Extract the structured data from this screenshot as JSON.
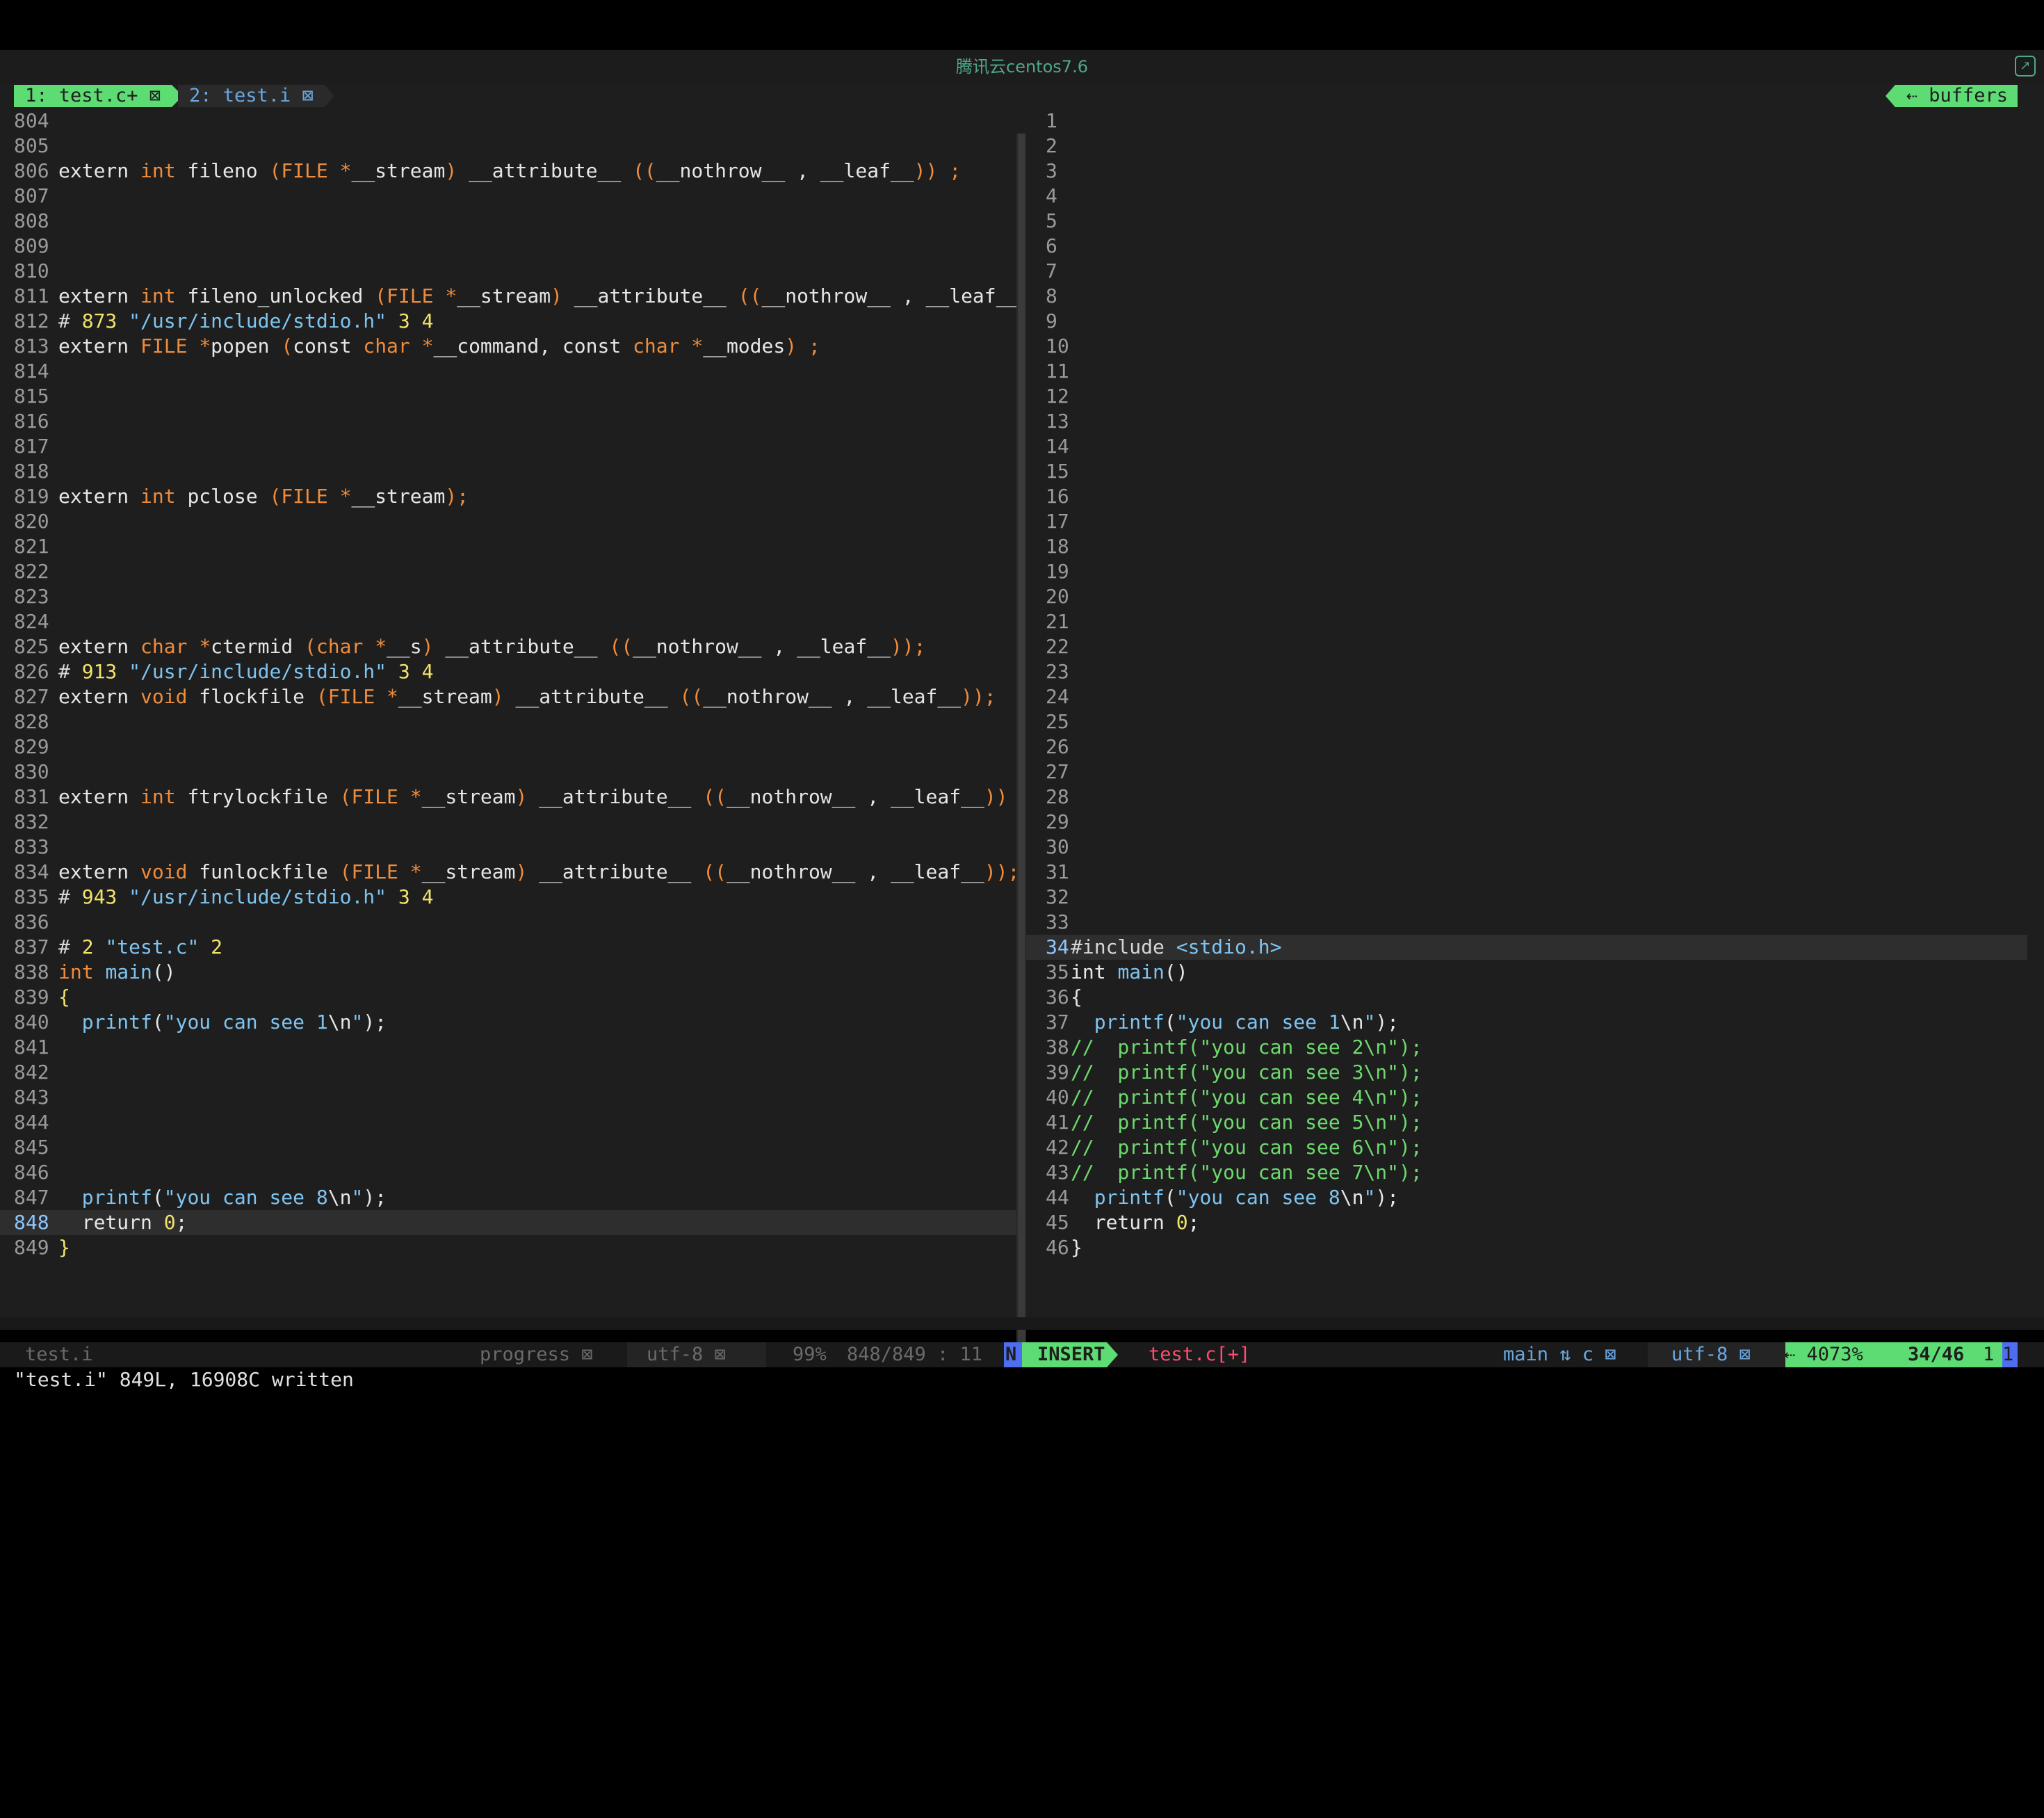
{
  "window": {
    "title": "腾讯云centos7.6",
    "share_icon": "share-icon"
  },
  "tabline": {
    "tabs": [
      {
        "label": "1: test.c+ ⊠",
        "active": true
      },
      {
        "label": "2: test.i ⊠",
        "active": false
      }
    ],
    "buffers_label": "⇠ buffers"
  },
  "left_pane": {
    "file": "test.i",
    "lines": [
      {
        "n": "804",
        "tokens": []
      },
      {
        "n": "805",
        "tokens": []
      },
      {
        "n": "806",
        "tokens": [
          [
            "kw",
            "extern "
          ],
          [
            "ty",
            "int"
          ],
          [
            "kw",
            " fileno "
          ],
          [
            "pn",
            "("
          ],
          [
            "ty",
            "FILE "
          ],
          [
            "pn",
            "*"
          ],
          [
            "kw",
            "__stream"
          ],
          [
            "pn",
            ")"
          ],
          [
            "kw",
            " __attribute__ "
          ],
          [
            "pn",
            "(("
          ],
          [
            "kw",
            "__nothrow__ , __leaf__"
          ],
          [
            "pn",
            "))"
          ],
          [
            "kw",
            " "
          ],
          [
            "pn",
            ";"
          ]
        ]
      },
      {
        "n": "807",
        "tokens": []
      },
      {
        "n": "808",
        "tokens": []
      },
      {
        "n": "809",
        "tokens": []
      },
      {
        "n": "810",
        "tokens": []
      },
      {
        "n": "811",
        "tokens": [
          [
            "kw",
            "extern "
          ],
          [
            "ty",
            "int"
          ],
          [
            "kw",
            " fileno_unlocked "
          ],
          [
            "pn",
            "("
          ],
          [
            "ty",
            "FILE "
          ],
          [
            "pn",
            "*"
          ],
          [
            "kw",
            "__stream"
          ],
          [
            "pn",
            ")"
          ],
          [
            "kw",
            " __attribute__ "
          ],
          [
            "pn",
            "(("
          ],
          [
            "kw",
            "__nothrow__ , __leaf__"
          ],
          [
            "pn",
            "))"
          ],
          [
            "kw",
            " "
          ],
          [
            "pn",
            ";"
          ]
        ]
      },
      {
        "n": "812",
        "tokens": [
          [
            "pp",
            "# "
          ],
          [
            "nm",
            "873"
          ],
          [
            "kw",
            " "
          ],
          [
            "st",
            "\"/usr/include/stdio.h\""
          ],
          [
            "kw",
            " "
          ],
          [
            "nm",
            "3 4"
          ]
        ]
      },
      {
        "n": "813",
        "tokens": [
          [
            "kw",
            "extern "
          ],
          [
            "ty",
            "FILE"
          ],
          [
            "kw",
            " "
          ],
          [
            "pn",
            "*"
          ],
          [
            "kw",
            "popen "
          ],
          [
            "pn",
            "("
          ],
          [
            "kw",
            "const "
          ],
          [
            "ty",
            "char"
          ],
          [
            "kw",
            " "
          ],
          [
            "pn",
            "*"
          ],
          [
            "kw",
            "__command, const "
          ],
          [
            "ty",
            "char"
          ],
          [
            "kw",
            " "
          ],
          [
            "pn",
            "*"
          ],
          [
            "kw",
            "__modes"
          ],
          [
            "pn",
            ")"
          ],
          [
            "kw",
            " "
          ],
          [
            "pn",
            ";"
          ]
        ]
      },
      {
        "n": "814",
        "tokens": []
      },
      {
        "n": "815",
        "tokens": []
      },
      {
        "n": "816",
        "tokens": []
      },
      {
        "n": "817",
        "tokens": []
      },
      {
        "n": "818",
        "tokens": []
      },
      {
        "n": "819",
        "tokens": [
          [
            "kw",
            "extern "
          ],
          [
            "ty",
            "int"
          ],
          [
            "kw",
            " pclose "
          ],
          [
            "pn",
            "("
          ],
          [
            "ty",
            "FILE "
          ],
          [
            "pn",
            "*"
          ],
          [
            "kw",
            "__stream"
          ],
          [
            "pn",
            ");"
          ]
        ]
      },
      {
        "n": "820",
        "tokens": []
      },
      {
        "n": "821",
        "tokens": []
      },
      {
        "n": "822",
        "tokens": []
      },
      {
        "n": "823",
        "tokens": []
      },
      {
        "n": "824",
        "tokens": []
      },
      {
        "n": "825",
        "tokens": [
          [
            "kw",
            "extern "
          ],
          [
            "ty",
            "char"
          ],
          [
            "kw",
            " "
          ],
          [
            "pn",
            "*"
          ],
          [
            "kw",
            "ctermid "
          ],
          [
            "pn",
            "("
          ],
          [
            "ty",
            "char"
          ],
          [
            "kw",
            " "
          ],
          [
            "pn",
            "*"
          ],
          [
            "kw",
            "__s"
          ],
          [
            "pn",
            ")"
          ],
          [
            "kw",
            " __attribute__ "
          ],
          [
            "pn",
            "(("
          ],
          [
            "kw",
            "__nothrow__ , __leaf__"
          ],
          [
            "pn",
            "));"
          ]
        ]
      },
      {
        "n": "826",
        "tokens": [
          [
            "pp",
            "# "
          ],
          [
            "nm",
            "913"
          ],
          [
            "kw",
            " "
          ],
          [
            "st",
            "\"/usr/include/stdio.h\""
          ],
          [
            "kw",
            " "
          ],
          [
            "nm",
            "3 4"
          ]
        ]
      },
      {
        "n": "827",
        "tokens": [
          [
            "kw",
            "extern "
          ],
          [
            "ty",
            "void"
          ],
          [
            "kw",
            " flockfile "
          ],
          [
            "pn",
            "("
          ],
          [
            "ty",
            "FILE "
          ],
          [
            "pn",
            "*"
          ],
          [
            "kw",
            "__stream"
          ],
          [
            "pn",
            ")"
          ],
          [
            "kw",
            " __attribute__ "
          ],
          [
            "pn",
            "(("
          ],
          [
            "kw",
            "__nothrow__ , __leaf__"
          ],
          [
            "pn",
            "));"
          ]
        ]
      },
      {
        "n": "828",
        "tokens": []
      },
      {
        "n": "829",
        "tokens": []
      },
      {
        "n": "830",
        "tokens": []
      },
      {
        "n": "831",
        "tokens": [
          [
            "kw",
            "extern "
          ],
          [
            "ty",
            "int"
          ],
          [
            "kw",
            " ftrylockfile "
          ],
          [
            "pn",
            "("
          ],
          [
            "ty",
            "FILE "
          ],
          [
            "pn",
            "*"
          ],
          [
            "kw",
            "__stream"
          ],
          [
            "pn",
            ")"
          ],
          [
            "kw",
            " __attribute__ "
          ],
          [
            "pn",
            "(("
          ],
          [
            "kw",
            "__nothrow__ , __leaf__"
          ],
          [
            "pn",
            "))"
          ],
          [
            "kw",
            " "
          ],
          [
            "pn",
            ";"
          ]
        ]
      },
      {
        "n": "832",
        "tokens": []
      },
      {
        "n": "833",
        "tokens": []
      },
      {
        "n": "834",
        "tokens": [
          [
            "kw",
            "extern "
          ],
          [
            "ty",
            "void"
          ],
          [
            "kw",
            " funlockfile "
          ],
          [
            "pn",
            "("
          ],
          [
            "ty",
            "FILE "
          ],
          [
            "pn",
            "*"
          ],
          [
            "kw",
            "__stream"
          ],
          [
            "pn",
            ")"
          ],
          [
            "kw",
            " __attribute__ "
          ],
          [
            "pn",
            "(("
          ],
          [
            "kw",
            "__nothrow__ , __leaf__"
          ],
          [
            "pn",
            "));"
          ]
        ]
      },
      {
        "n": "835",
        "tokens": [
          [
            "pp",
            "# "
          ],
          [
            "nm",
            "943"
          ],
          [
            "kw",
            " "
          ],
          [
            "st",
            "\"/usr/include/stdio.h\""
          ],
          [
            "kw",
            " "
          ],
          [
            "nm",
            "3 4"
          ]
        ]
      },
      {
        "n": "836",
        "tokens": []
      },
      {
        "n": "837",
        "tokens": [
          [
            "pp",
            "# "
          ],
          [
            "nm",
            "2"
          ],
          [
            "kw",
            " "
          ],
          [
            "st",
            "\"test.c\""
          ],
          [
            "kw",
            " "
          ],
          [
            "nm",
            "2"
          ]
        ]
      },
      {
        "n": "838",
        "tokens": [
          [
            "ty",
            "int"
          ],
          [
            "kw",
            " "
          ],
          [
            "st",
            "main"
          ],
          [
            "kw",
            "()"
          ]
        ]
      },
      {
        "n": "839",
        "tokens": [
          [
            "nm",
            "{"
          ]
        ]
      },
      {
        "n": "840",
        "tokens": [
          [
            "kw",
            "  "
          ],
          [
            "st",
            "printf"
          ],
          [
            "kw",
            "("
          ],
          [
            "st",
            "\"you can see 1"
          ],
          [
            "kw",
            "\\n"
          ],
          [
            "st",
            "\""
          ],
          [
            "kw",
            ");"
          ]
        ]
      },
      {
        "n": "841",
        "tokens": []
      },
      {
        "n": "842",
        "tokens": []
      },
      {
        "n": "843",
        "tokens": []
      },
      {
        "n": "844",
        "tokens": []
      },
      {
        "n": "845",
        "tokens": []
      },
      {
        "n": "846",
        "tokens": []
      },
      {
        "n": "847",
        "tokens": [
          [
            "kw",
            "  "
          ],
          [
            "st",
            "printf"
          ],
          [
            "kw",
            "("
          ],
          [
            "st",
            "\"you can see 8"
          ],
          [
            "kw",
            "\\n"
          ],
          [
            "st",
            "\""
          ],
          [
            "kw",
            ");"
          ]
        ]
      },
      {
        "n": "848",
        "tokens": [
          [
            "kw",
            "  return "
          ],
          [
            "nm",
            "0"
          ],
          [
            "kw",
            ";"
          ]
        ],
        "current": true
      },
      {
        "n": "849",
        "tokens": [
          [
            "nm",
            "}"
          ]
        ]
      }
    ]
  },
  "right_pane": {
    "file": "test.c",
    "lines": [
      {
        "n": "1",
        "tokens": []
      },
      {
        "n": "2",
        "tokens": []
      },
      {
        "n": "3",
        "tokens": []
      },
      {
        "n": "4",
        "tokens": []
      },
      {
        "n": "5",
        "tokens": []
      },
      {
        "n": "6",
        "tokens": []
      },
      {
        "n": "7",
        "tokens": []
      },
      {
        "n": "8",
        "tokens": []
      },
      {
        "n": "9",
        "tokens": []
      },
      {
        "n": "10",
        "tokens": []
      },
      {
        "n": "11",
        "tokens": []
      },
      {
        "n": "12",
        "tokens": []
      },
      {
        "n": "13",
        "tokens": []
      },
      {
        "n": "14",
        "tokens": []
      },
      {
        "n": "15",
        "tokens": []
      },
      {
        "n": "16",
        "tokens": []
      },
      {
        "n": "17",
        "tokens": []
      },
      {
        "n": "18",
        "tokens": []
      },
      {
        "n": "19",
        "tokens": []
      },
      {
        "n": "20",
        "tokens": []
      },
      {
        "n": "21",
        "tokens": []
      },
      {
        "n": "22",
        "tokens": []
      },
      {
        "n": "23",
        "tokens": []
      },
      {
        "n": "24",
        "tokens": []
      },
      {
        "n": "25",
        "tokens": []
      },
      {
        "n": "26",
        "tokens": []
      },
      {
        "n": "27",
        "tokens": []
      },
      {
        "n": "28",
        "tokens": []
      },
      {
        "n": "29",
        "tokens": []
      },
      {
        "n": "30",
        "tokens": []
      },
      {
        "n": "31",
        "tokens": []
      },
      {
        "n": "32",
        "tokens": []
      },
      {
        "n": "33",
        "tokens": []
      },
      {
        "n": "34",
        "tokens": [
          [
            "pp",
            "#include "
          ],
          [
            "inc",
            "<stdio.h>"
          ]
        ],
        "current": true
      },
      {
        "n": "35",
        "tokens": [
          [
            "kw",
            "int "
          ],
          [
            "st",
            "main"
          ],
          [
            "kw",
            "()"
          ]
        ]
      },
      {
        "n": "36",
        "tokens": [
          [
            "kw",
            "{"
          ]
        ]
      },
      {
        "n": "37",
        "tokens": [
          [
            "kw",
            "  "
          ],
          [
            "st",
            "printf"
          ],
          [
            "kw",
            "("
          ],
          [
            "st",
            "\"you can see 1"
          ],
          [
            "kw",
            "\\n"
          ],
          [
            "st",
            "\""
          ],
          [
            "kw",
            ");"
          ]
        ]
      },
      {
        "n": "38",
        "tokens": [
          [
            "cm",
            "//  printf(\"you can see 2\\n\");"
          ]
        ]
      },
      {
        "n": "39",
        "tokens": [
          [
            "cm",
            "//  printf(\"you can see 3\\n\");"
          ]
        ]
      },
      {
        "n": "40",
        "tokens": [
          [
            "cm",
            "//  printf(\"you can see 4\\n\");"
          ]
        ]
      },
      {
        "n": "41",
        "tokens": [
          [
            "cm",
            "//  printf(\"you can see 5\\n\");"
          ]
        ]
      },
      {
        "n": "42",
        "tokens": [
          [
            "cm",
            "//  printf(\"you can see 6\\n\");"
          ]
        ]
      },
      {
        "n": "43",
        "tokens": [
          [
            "cm",
            "//  printf(\"you can see 7\\n\");"
          ]
        ]
      },
      {
        "n": "44",
        "tokens": [
          [
            "kw",
            "  "
          ],
          [
            "st",
            "printf"
          ],
          [
            "kw",
            "("
          ],
          [
            "st",
            "\"you can see 8"
          ],
          [
            "kw",
            "\\n"
          ],
          [
            "st",
            "\""
          ],
          [
            "kw",
            ");"
          ]
        ]
      },
      {
        "n": "45",
        "tokens": [
          [
            "kw",
            "  return "
          ],
          [
            "nm",
            "0"
          ],
          [
            "kw",
            ";"
          ]
        ]
      },
      {
        "n": "46",
        "tokens": [
          [
            "kw",
            "}"
          ]
        ]
      }
    ]
  },
  "statusline": {
    "left_file": "test.i",
    "left_progress": "progress ⊠",
    "left_encoding": "utf-8 ⊠",
    "left_percent": "99%",
    "left_position": "848/849 : 11",
    "mode_short": "N",
    "mode": "INSERT",
    "right_file": "test.c[+]",
    "branch": "main ⇅ c ⊠",
    "right_encoding": "utf-8 ⊠",
    "right_percent": "⇠ 4073%",
    "right_position": "34/46",
    "right_col": "1",
    "right_col_end": "1"
  },
  "cmdline": {
    "message": "\"test.i\" 849L, 16908C written"
  },
  "colors": {
    "accent_green": "#5ddc74",
    "mode_blue": "#4f6df0",
    "title_green": "#4fa889",
    "error_red": "#ff4d6d"
  }
}
